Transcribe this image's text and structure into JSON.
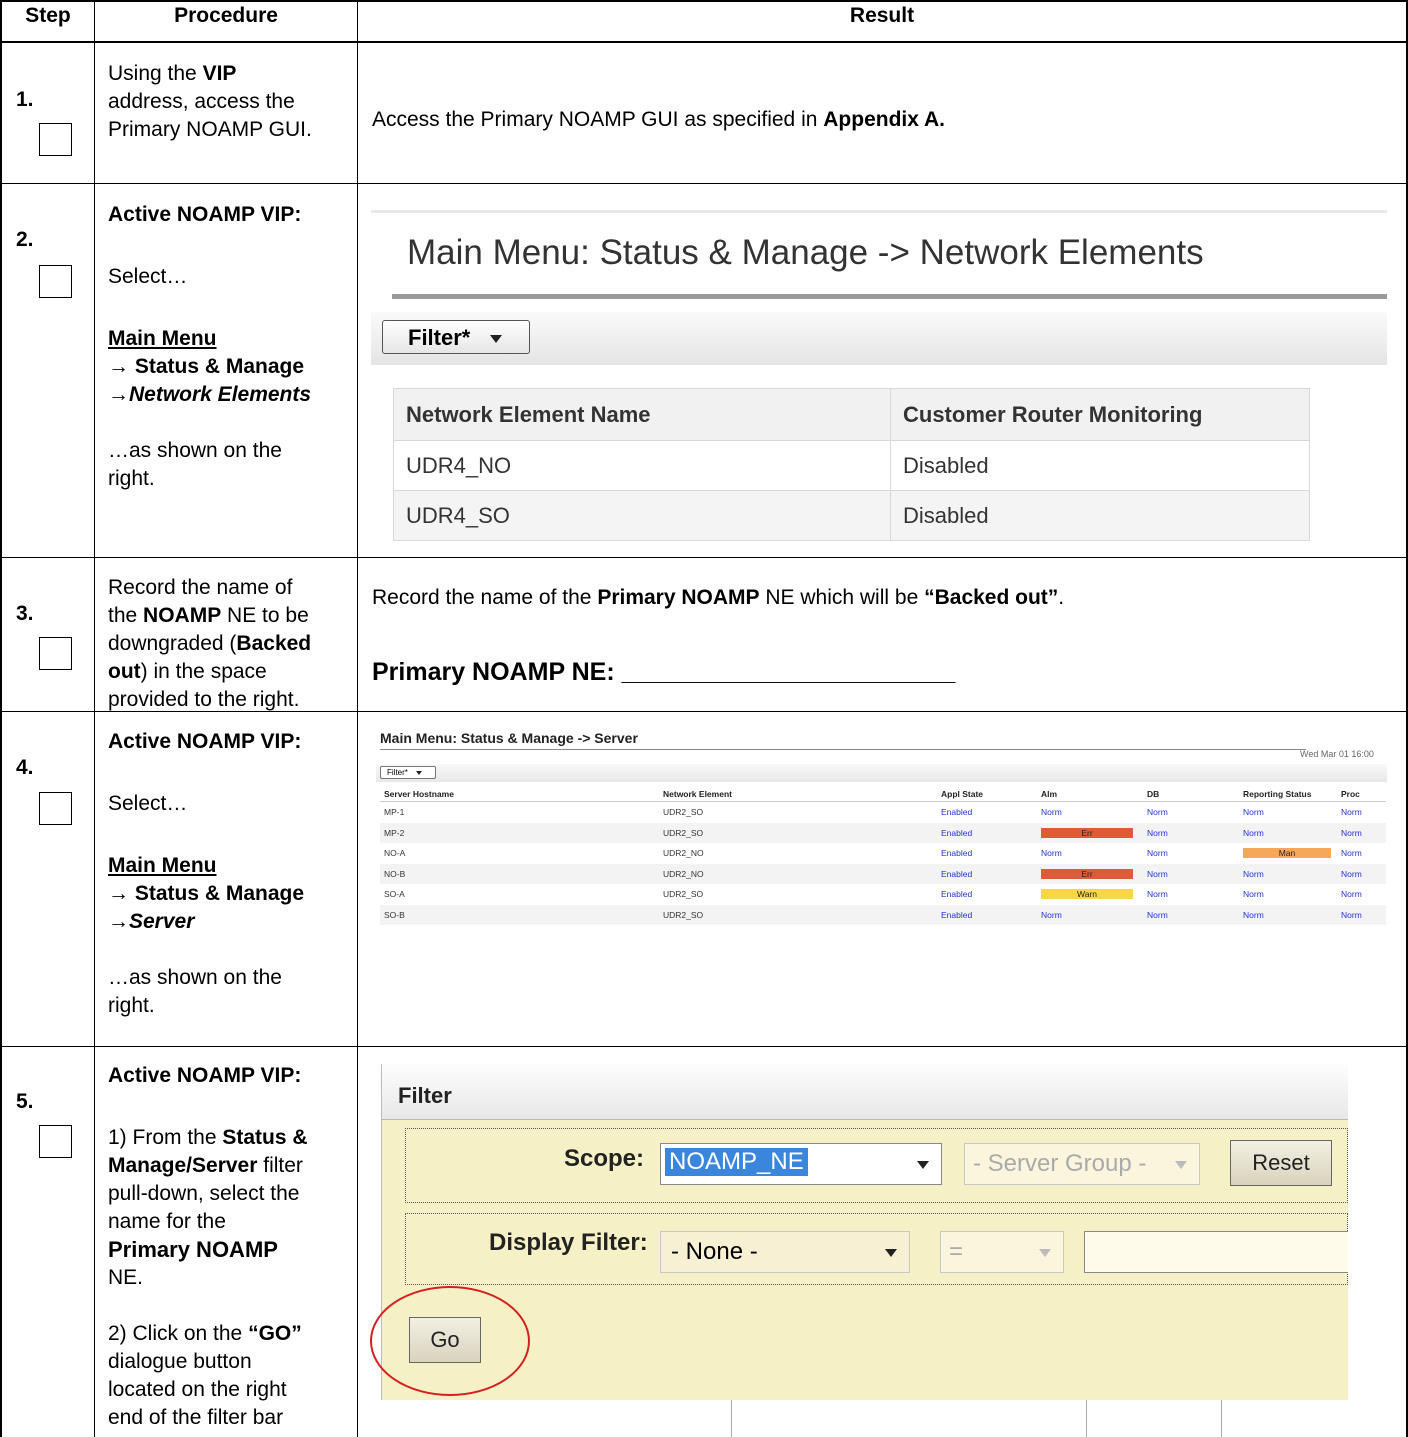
{
  "header": {
    "step": "Step",
    "procedure": "Procedure",
    "result": "Result"
  },
  "step1": {
    "num": "1.",
    "proc_a": "Using the ",
    "proc_b": "VIP",
    "proc_c": "address, access the Primary NOAMP GUI.",
    "result_a": "Access the Primary NOAMP GUI as specified in ",
    "result_b": "Appendix A."
  },
  "step2": {
    "num": "2.",
    "proc_title": "Active NOAMP VIP:",
    "proc_select": "Select…",
    "menu1": "Main Menu",
    "menu2": "→ Status & Manage",
    "menu3": "→Network Elements",
    "proc_end": "…as shown on the right.",
    "screen_title": "Main Menu: Status & Manage -> Network Elements",
    "filter": "Filter*",
    "columns": [
      "Network Element Name",
      "Customer Router Monitoring"
    ],
    "rows": [
      [
        "UDR4_NO",
        "Disabled"
      ],
      [
        "UDR4_SO",
        "Disabled"
      ]
    ]
  },
  "step3": {
    "num": "3.",
    "proc": [
      "Record the name of",
      "the ",
      "NOAMP",
      " NE to be",
      "downgraded (",
      "Backed",
      "out",
      ") in the space",
      "provided to the right."
    ],
    "result_a": "Record the name of the ",
    "result_b": "Primary NOAMP",
    "result_c": " NE which will be ",
    "result_d": "“Backed out”",
    "result_e": ".",
    "field_label": "Primary NOAMP NE: ________________________"
  },
  "step4": {
    "num": "4.",
    "proc_title": "Active NOAMP VIP:",
    "proc_select": "Select…",
    "menu1": "Main Menu",
    "menu2": "→ Status & Manage",
    "menu3": "→Server",
    "proc_end": "…as shown on the right.",
    "screen_title": "Main Menu: Status & Manage -> Server",
    "date": "Wed Mar 01 16:00",
    "filter": "Filter*",
    "columns": [
      "Server Hostname",
      "Network Element",
      "Appl State",
      "Alm",
      "DB",
      "Reporting Status",
      "Proc"
    ],
    "rows": [
      [
        "MP-1",
        "UDR2_SO",
        "Enabled",
        "Norm",
        "Norm",
        "Norm",
        "Norm"
      ],
      [
        "MP-2",
        "UDR2_SO",
        "Enabled",
        "Err",
        "Norm",
        "Norm",
        "Norm"
      ],
      [
        "NO-A",
        "UDR2_NO",
        "Enabled",
        "Norm",
        "Norm",
        "Man",
        "Norm"
      ],
      [
        "NO-B",
        "UDR2_NO",
        "Enabled",
        "Err",
        "Norm",
        "Norm",
        "Norm"
      ],
      [
        "SO-A",
        "UDR2_SO",
        "Enabled",
        "Warn",
        "Norm",
        "Norm",
        "Norm"
      ],
      [
        "SO-B",
        "UDR2_SO",
        "Enabled",
        "Norm",
        "Norm",
        "Norm",
        "Norm"
      ]
    ]
  },
  "step5": {
    "num": "5.",
    "proc_title": "Active NOAMP VIP:",
    "p1a": "1) From the ",
    "p1b": "Status &",
    "p1c": "Manage/Server",
    "p1d": " filter",
    "p1e": "pull-down, select the",
    "p1f": "name for the",
    "p1g": "Primary NOAMP",
    "p1h": "NE.",
    "p2a": "2) Click on the ",
    "p2b": "“GO”",
    "p2c": "dialogue button",
    "p2d": "located on the right",
    "p2e": "end of the filter bar",
    "screen_title": "Filter",
    "scope_label": "Scope:",
    "scope_value": "NOAMP_NE",
    "server_group": "- Server Group -",
    "reset": "Reset",
    "display_label": "Display Filter:",
    "display_value": "- None -",
    "op_value": "=",
    "go": "Go",
    "highlight_color": "#d42020"
  }
}
